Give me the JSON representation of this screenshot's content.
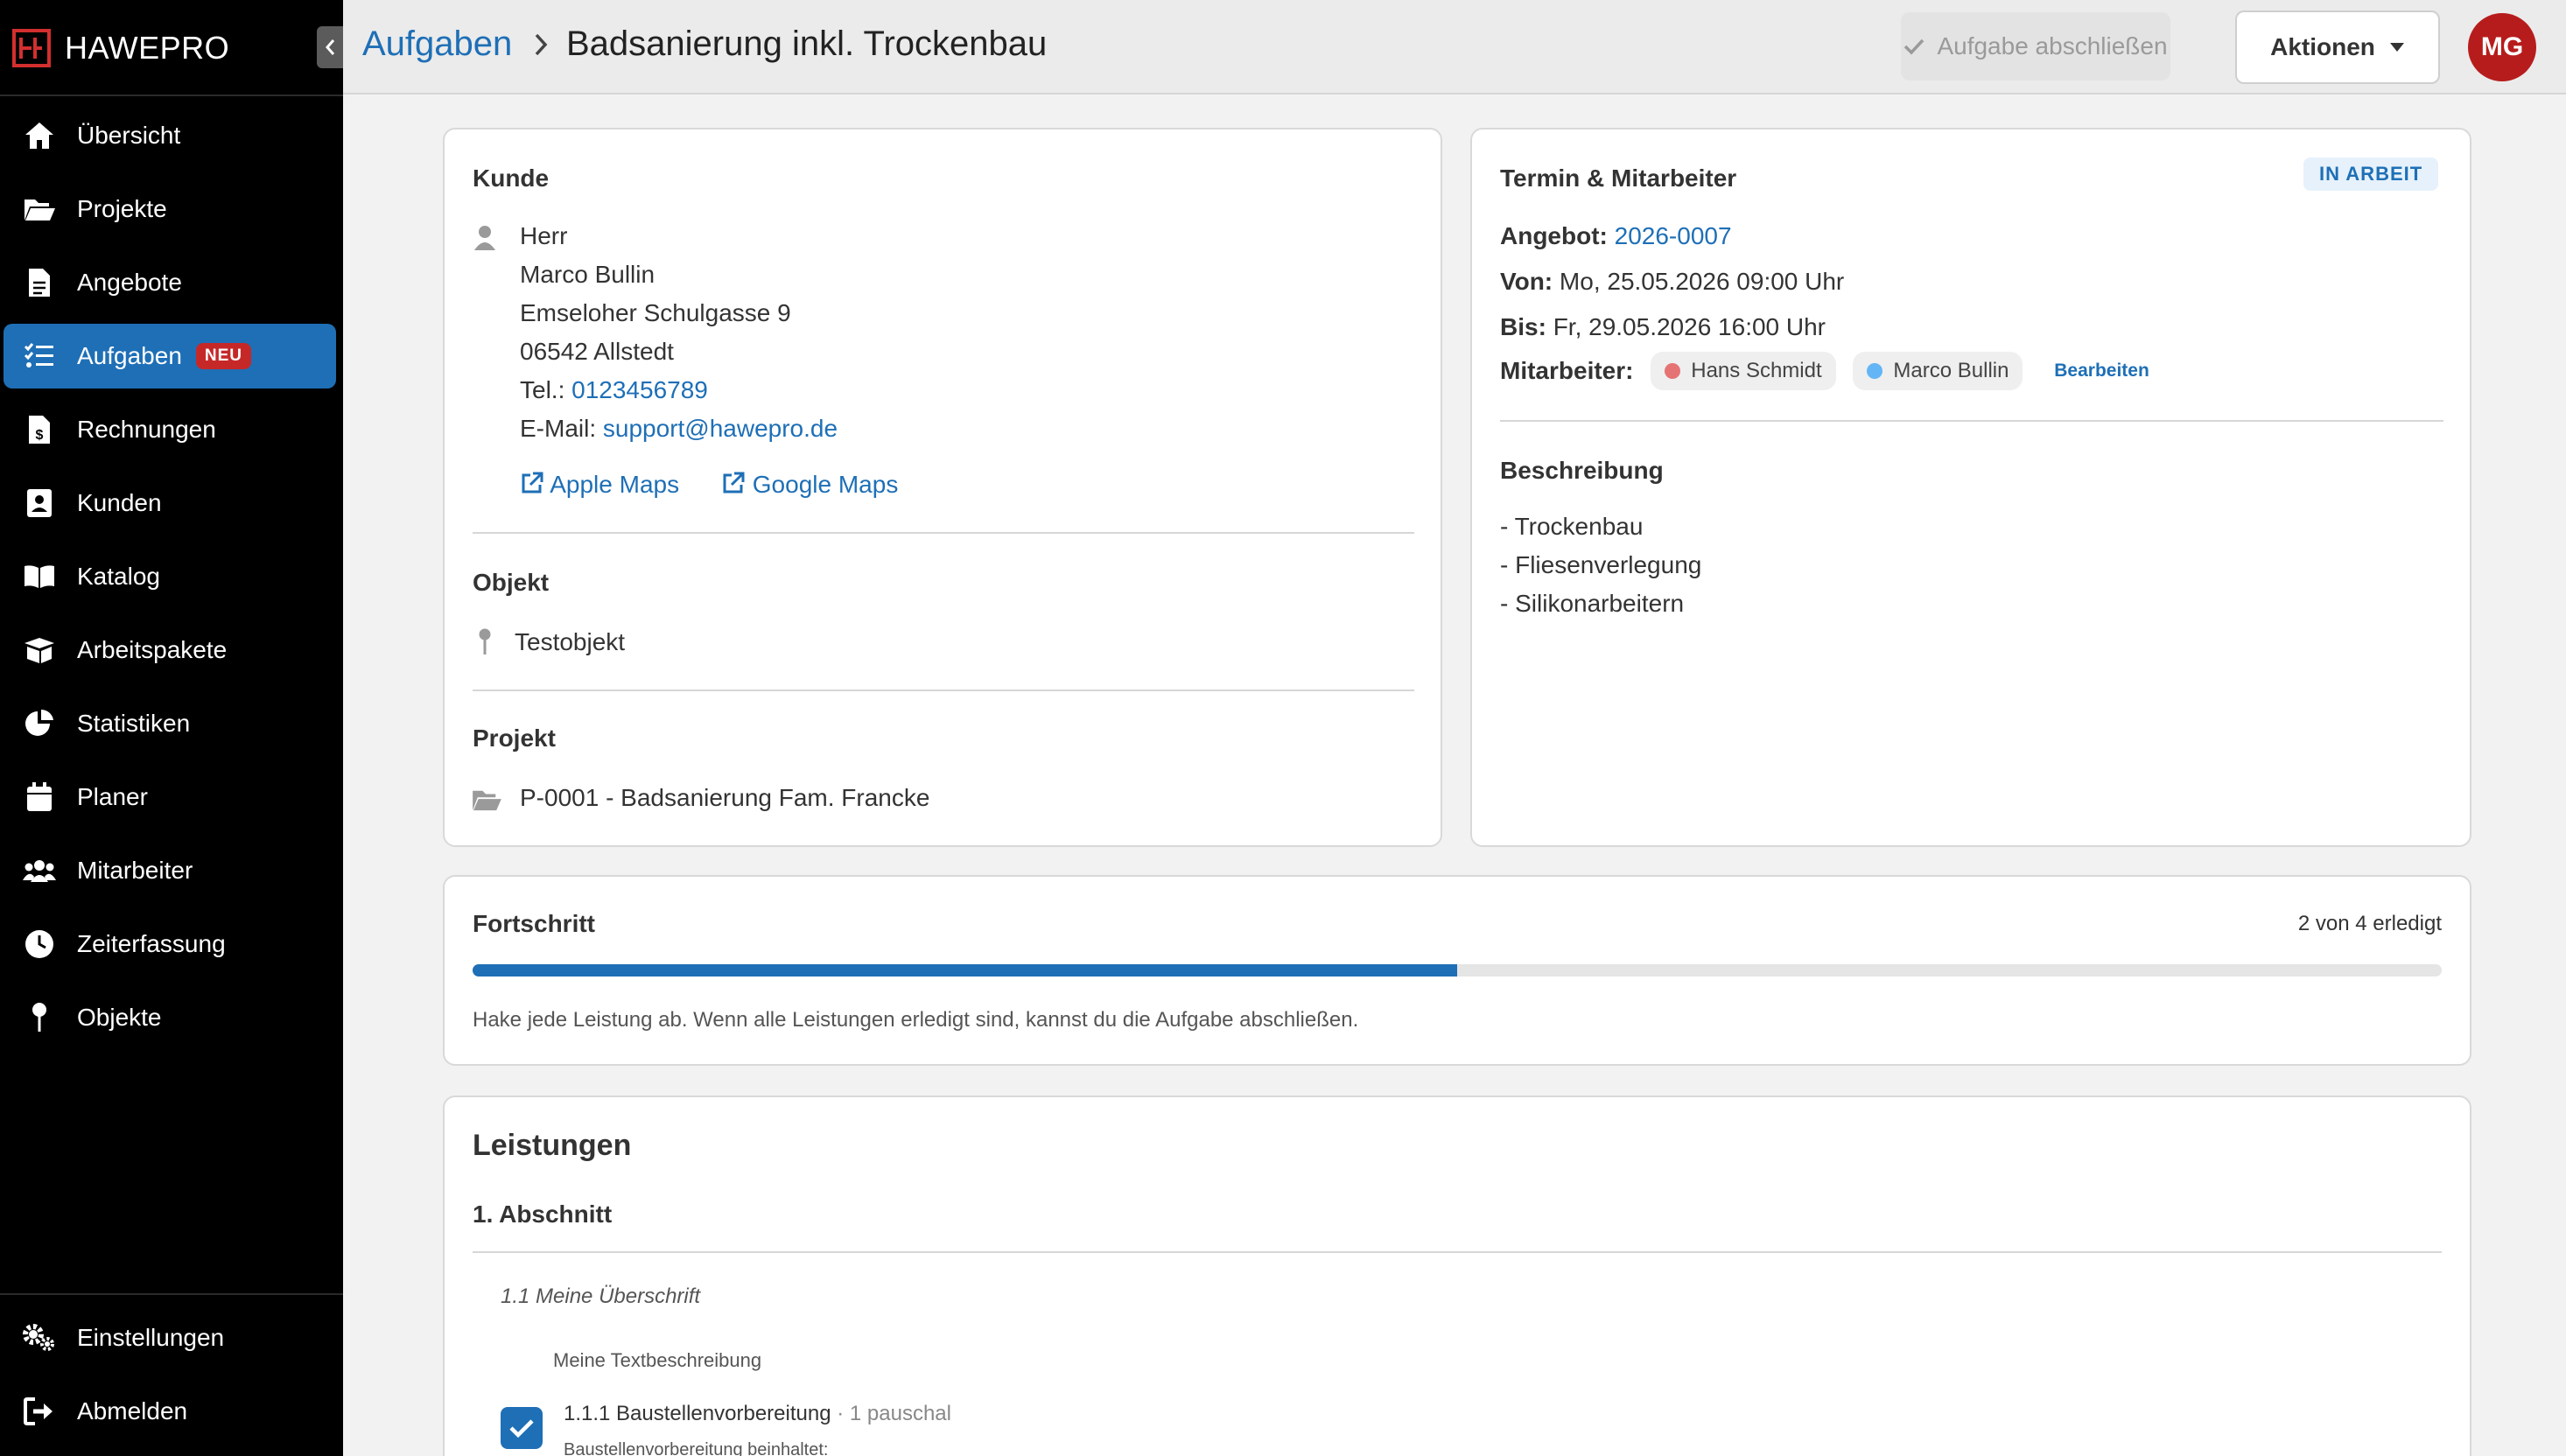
{
  "app": {
    "brand": "HAWEPRO"
  },
  "sidebar": {
    "items": [
      {
        "label": "Übersicht",
        "icon": "home-icon"
      },
      {
        "label": "Projekte",
        "icon": "folder-open-icon"
      },
      {
        "label": "Angebote",
        "icon": "document-icon"
      },
      {
        "label": "Aufgaben",
        "icon": "tasks-icon",
        "badge": "NEU",
        "active": true
      },
      {
        "label": "Rechnungen",
        "icon": "invoice-icon"
      },
      {
        "label": "Kunden",
        "icon": "contact-card-icon"
      },
      {
        "label": "Katalog",
        "icon": "book-icon"
      },
      {
        "label": "Arbeitspakete",
        "icon": "box-icon"
      },
      {
        "label": "Statistiken",
        "icon": "pie-chart-icon"
      },
      {
        "label": "Planer",
        "icon": "calendar-icon"
      },
      {
        "label": "Mitarbeiter",
        "icon": "users-icon"
      },
      {
        "label": "Zeiterfassung",
        "icon": "clock-icon"
      },
      {
        "label": "Objekte",
        "icon": "pin-icon"
      }
    ],
    "bottom": [
      {
        "label": "Einstellungen",
        "icon": "gears-icon"
      },
      {
        "label": "Abmelden",
        "icon": "sign-out-icon"
      }
    ]
  },
  "header": {
    "breadcrumb_parent": "Aufgaben",
    "title": "Badsanierung inkl. Trockenbau",
    "complete_label": "Aufgabe abschließen",
    "actions_label": "Aktionen",
    "avatar_initials": "MG"
  },
  "customer": {
    "heading": "Kunde",
    "salutation": "Herr",
    "name": "Marco Bullin",
    "street": "Emseloher Schulgasse 9",
    "city": "06542 Allstedt",
    "phone_label": "Tel.:",
    "phone": "0123456789",
    "email_label": "E-Mail:",
    "email": "support@hawepro.de",
    "apple_maps": "Apple Maps",
    "google_maps": "Google Maps",
    "object_heading": "Objekt",
    "object_name": "Testobjekt",
    "project_heading": "Projekt",
    "project_name": "P-0001 - Badsanierung Fam. Francke"
  },
  "schedule": {
    "heading": "Termin & Mitarbeiter",
    "status": "IN ARBEIT",
    "offer_label": "Angebot:",
    "offer_number": "2026-0007",
    "from_label": "Von:",
    "from_value": "Mo, 25.05.2026 09:00 Uhr",
    "to_label": "Bis:",
    "to_value": "Fr, 29.05.2026 16:00 Uhr",
    "staff_label": "Mitarbeiter:",
    "staff": [
      {
        "name": "Hans Schmidt",
        "color": "#e57373"
      },
      {
        "name": "Marco Bullin",
        "color": "#64b5f6"
      }
    ],
    "edit_label": "Bearbeiten",
    "description_heading": "Beschreibung",
    "description_lines": [
      "- Trockenbau",
      "- Fliesenverlegung",
      "- Silikonarbeitern"
    ]
  },
  "progress": {
    "heading": "Fortschritt",
    "count_text": "2 von 4 erledigt",
    "fraction": 0.5,
    "hint": "Hake jede Leistung ab. Wenn alle Leistungen erledigt sind, kannst du die Aufgabe abschließen."
  },
  "services": {
    "heading": "Leistungen",
    "section_title": "1. Abschnitt",
    "subheading": "1.1 Meine Überschrift",
    "text_description": "Meine Textbeschreibung",
    "item_title": "1.1.1 Baustellenvorbereitung",
    "item_qty": "· 1 pauschal",
    "item_detail": "Baustellenvorbereitung beinhaltet:"
  },
  "colors": {
    "accent": "#1e6fb6",
    "danger": "#c62828",
    "sidebar_bg": "#000000"
  }
}
